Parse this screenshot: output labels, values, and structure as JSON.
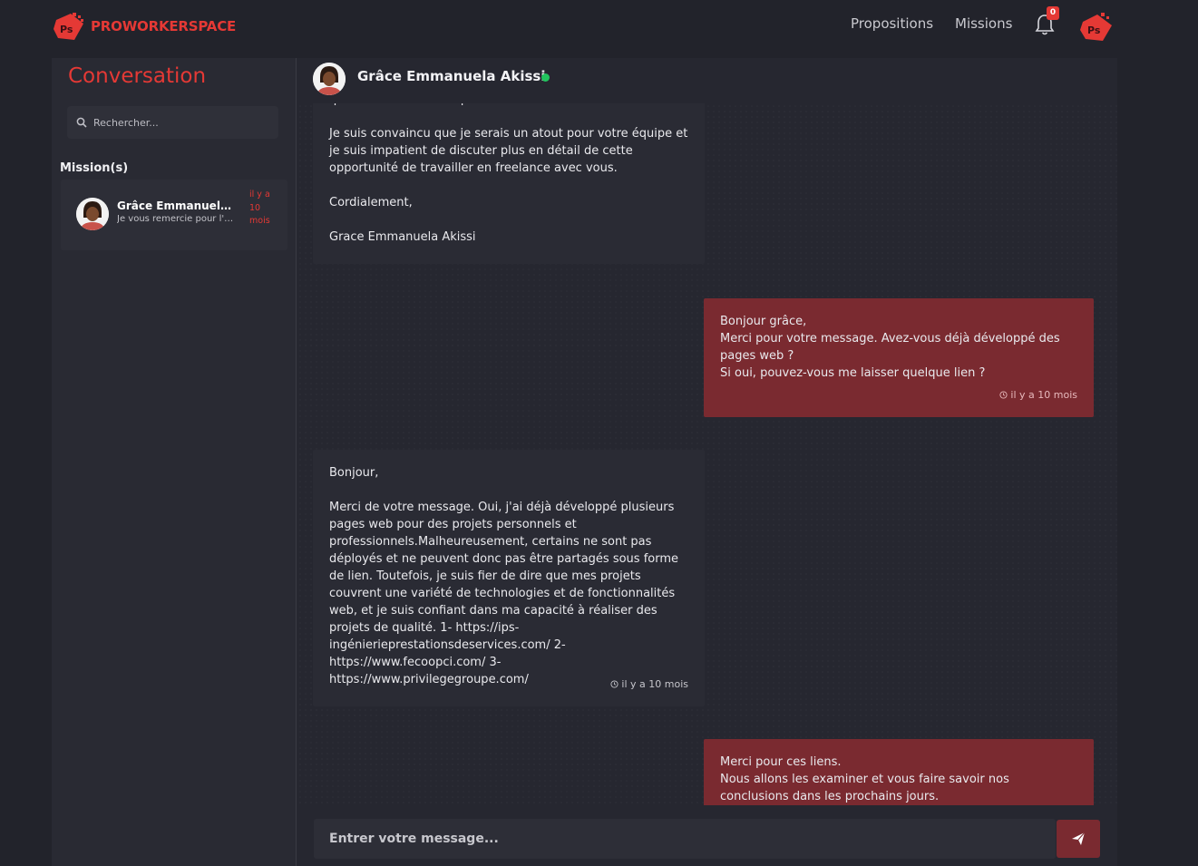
{
  "brand": {
    "name": "PROWORKERSPACE",
    "logo_icon": "ps-logo-icon",
    "accent": "#e53935"
  },
  "nav": {
    "propositions": "Propositions",
    "missions": "Missions",
    "notifications_count": "0"
  },
  "sidebar": {
    "title": "Conversation",
    "search_placeholder": "Rechercher...",
    "section": "Mission(s)",
    "conversations": [
      {
        "name": "Grâce Emmanuela Akissi",
        "preview": "Je vous remercie pour l'opportunité",
        "time": "il y a 10 mois"
      }
    ]
  },
  "chat": {
    "contact_name": "Grâce Emmanuela Akissi",
    "status": "online",
    "messages": [
      {
        "direction": "in",
        "text": "que les standards de qualité soient maintenus.\n\nJe suis convaincu que je serais un atout pour votre équipe et je suis impatient de discuter plus en détail de cette opportunité de travailler en freelance avec vous.\n\nCordialement,\n\nGrace Emmanuela Akissi",
        "time": ""
      },
      {
        "direction": "out",
        "text": "Bonjour grâce,\nMerci pour votre message. Avez-vous déjà développé des pages web ?\nSi oui, pouvez-vous me laisser quelque lien ?",
        "time": "il y a 10 mois"
      },
      {
        "direction": "in",
        "text": "Bonjour,\n\nMerci de votre message. Oui, j'ai déjà développé plusieurs pages web pour des projets personnels et professionnels.Malheureusement, certains ne sont pas déployés et ne peuvent donc pas être partagés sous forme de lien. Toutefois, je suis fier de dire que mes projets couvrent une variété de technologies et de fonctionnalités web, et je suis confiant dans ma capacité à réaliser des projets de qualité. 1- https://ips-ingénierieprestationsdeservices.com/ 2- https://www.fecoopci.com/ 3- https://www.privilegegroupe.com/",
        "time": "il y a 10 mois"
      },
      {
        "direction": "out",
        "text": "Merci pour ces liens.\nNous allons les examiner et vous faire savoir nos conclusions dans les prochains jours.",
        "time": ""
      }
    ]
  },
  "composer": {
    "placeholder": "Entrer votre message..."
  }
}
